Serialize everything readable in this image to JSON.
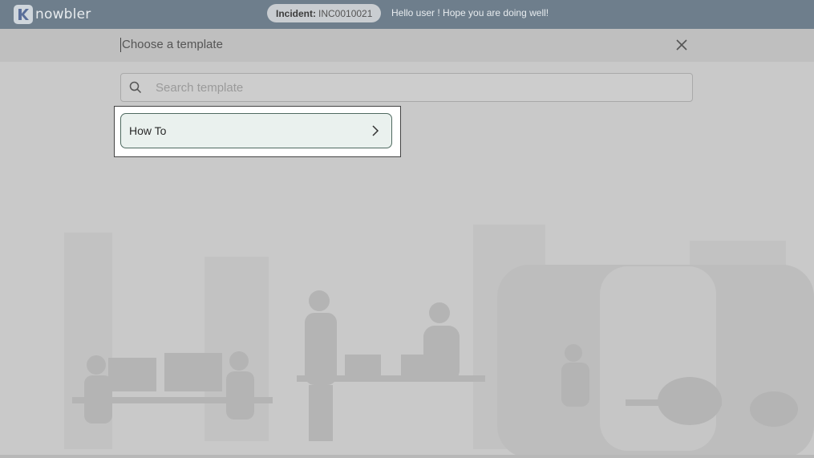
{
  "app": {
    "logo_text": "nowbler"
  },
  "topbar": {
    "incident_label": "Incident:",
    "incident_value": "INC0010021",
    "greeting": "Hello user ! Hope you are doing well!"
  },
  "modal": {
    "title": "Choose a template",
    "search": {
      "placeholder": "Search template",
      "value": ""
    },
    "templates": [
      {
        "label": "How To"
      }
    ]
  },
  "icons": {
    "logo": "nowbler-logo-icon",
    "close": "close-icon",
    "search": "search-icon",
    "chevron": "chevron-right-icon"
  },
  "colors": {
    "topbar": "#6e7e8c",
    "overlay": "#c9c9c9",
    "card_bg": "#eaf1ee",
    "card_border": "#4f6a60"
  }
}
